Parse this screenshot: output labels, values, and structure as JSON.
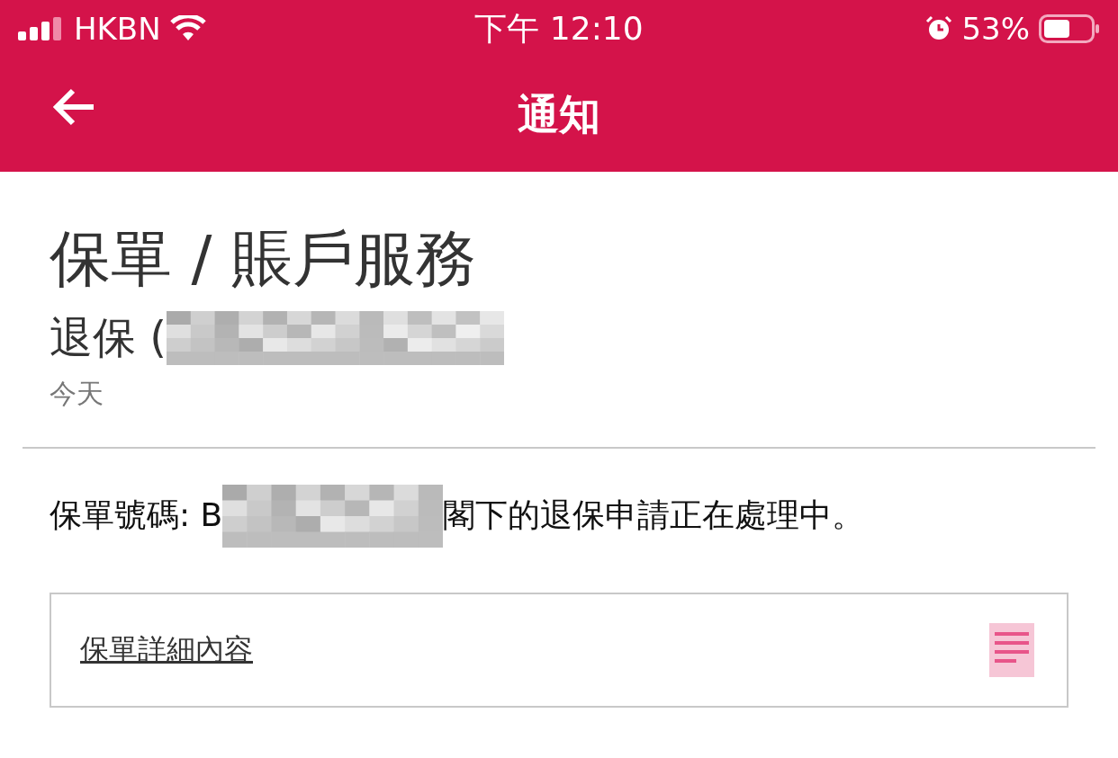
{
  "status_bar": {
    "carrier": "HKBN",
    "time": "下午 12:10",
    "battery": "53%"
  },
  "nav": {
    "title": "通知"
  },
  "notification": {
    "category": "保單 / 賬戶服務",
    "subject": "退保 (",
    "date": "今天",
    "message_start": "保單號碼: B",
    "message_end": "閣下的退保申請正在處理中。",
    "link": "保單詳細內容"
  }
}
